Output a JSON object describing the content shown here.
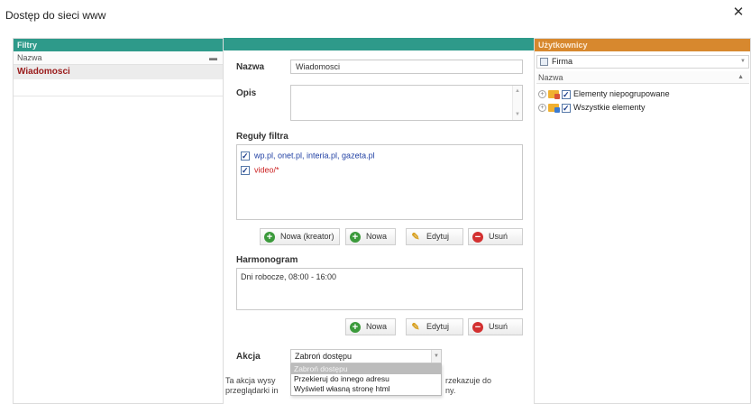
{
  "window": {
    "title": "Dostęp do sieci www",
    "close_symbol": "✕"
  },
  "filters_panel": {
    "header": "Filtry",
    "column_header": "Nazwa",
    "items": [
      "Wiadomosci"
    ]
  },
  "form": {
    "name_label": "Nazwa",
    "name_value": "Wiadomosci",
    "description_label": "Opis",
    "description_value": "",
    "rules_label": "Reguły filtra",
    "rules": [
      {
        "text": "wp.pl, onet.pl, interia.pl, gazeta.pl",
        "checked": true,
        "color": "#1f3fa3"
      },
      {
        "text": "video/*",
        "checked": true,
        "color": "#cc2222"
      }
    ],
    "rules_buttons": {
      "new_wizard": "Nowa (kreator)",
      "new": "Nowa",
      "edit": "Edytuj",
      "delete": "Usuń"
    },
    "schedule_label": "Harmonogram",
    "schedule_items": [
      "Dni robocze, 08:00 - 16:00"
    ],
    "schedule_buttons": {
      "new": "Nowa",
      "edit": "Edytuj",
      "delete": "Usuń"
    },
    "action_label": "Akcja",
    "action_value": "Zabroń dostępu",
    "action_options": [
      "Zabroń dostępu",
      "Przekieruj do innego adresu",
      "Wyświetl własną stronę html"
    ],
    "action_desc_left_1": "Ta akcja wysy",
    "action_desc_left_2": "przeglądarki in",
    "action_desc_right_1": "rzekazuje do",
    "action_desc_right_2": "ny."
  },
  "users_panel": {
    "header": "Użytkownicy",
    "selector_value": "Firma",
    "column_header": "Nazwa",
    "tree": [
      {
        "label": "Elementy niepogrupowane",
        "checked": true
      },
      {
        "label": "Wszystkie elementy",
        "checked": true
      }
    ]
  },
  "colors": {
    "filters_header": "#2e9a8a",
    "users_header": "#d7882e",
    "selected_item_text": "#9a1b1b"
  }
}
